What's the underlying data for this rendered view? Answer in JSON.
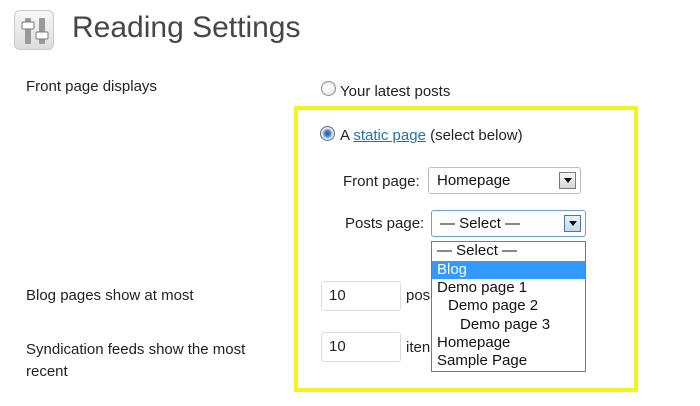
{
  "header": {
    "title": "Reading Settings",
    "icon": "settings-sliders-icon"
  },
  "front_page_displays": {
    "label": "Front page displays",
    "option_latest": "Your latest posts",
    "option_static_prefix": "A",
    "option_static_link": "static page",
    "option_static_suffix": "(select below)",
    "selected": "static page"
  },
  "front_page_select": {
    "label": "Front page:",
    "value": "Homepage"
  },
  "posts_page_select": {
    "label": "Posts page:",
    "value": "— Select —",
    "options": [
      "— Select —",
      "Blog",
      "Demo page 1",
      "Demo page 2",
      "Demo page 3",
      "Homepage",
      "Sample Page"
    ],
    "highlighted_option": "Blog"
  },
  "blog_pages": {
    "label": "Blog pages show at most",
    "value": "10",
    "suffix": "pos"
  },
  "syndication": {
    "label_line1": "Syndication feeds show the most",
    "label_line2": "recent",
    "value": "10",
    "suffix": "iten"
  },
  "colors": {
    "highlight_border": "#f7f21c",
    "link": "#21759b",
    "option_highlight": "#3399ff"
  }
}
